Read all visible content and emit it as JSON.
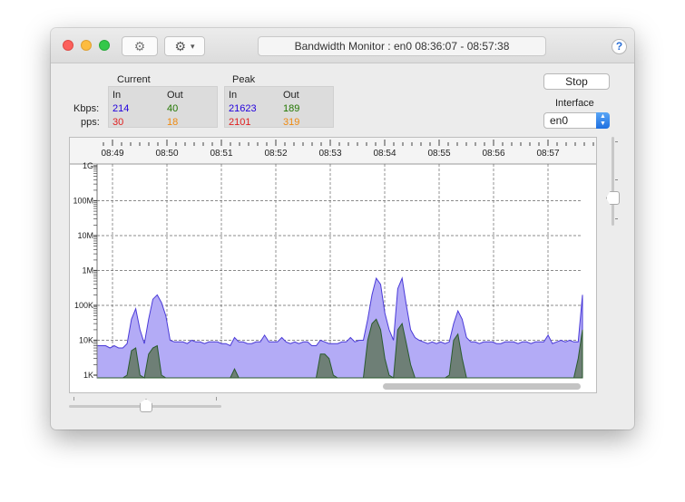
{
  "window": {
    "title": "Bandwidth Monitor : en0 08:36:07 - 08:57:38",
    "help_label": "?"
  },
  "stats": {
    "current": {
      "heading": "Current",
      "in_label": "In",
      "out_label": "Out",
      "kbps_in": "214",
      "kbps_out": "40",
      "pps_in": "30",
      "pps_out": "18"
    },
    "peak": {
      "heading": "Peak",
      "in_label": "In",
      "out_label": "Out",
      "kbps_in": "21623",
      "kbps_out": "189",
      "pps_in": "2101",
      "pps_out": "319"
    },
    "kbps_label": "Kbps:",
    "pps_label": "pps:"
  },
  "controls": {
    "stop_label": "Stop",
    "interface_label": "Interface",
    "interface_value": "en0"
  },
  "colors": {
    "in_kbps": "#2200dd",
    "out_kbps": "#227700",
    "in_pps": "#e02020",
    "out_pps": "#ef8a10",
    "in_fill": "#b3abf6",
    "in_line": "#4a3ad8",
    "out_fill": "#6e7f76",
    "out_line": "#2a5a2e"
  },
  "chart_data": {
    "type": "area",
    "time_labels": [
      "08:49",
      "08:50",
      "08:51",
      "08:52",
      "08:53",
      "08:54",
      "08:55",
      "08:56",
      "08:57"
    ],
    "y_scale": "log",
    "y_labels": [
      "1G",
      "100M",
      "10M",
      "1M",
      "100K",
      "10K",
      "1K"
    ],
    "series": [
      {
        "values": [
          7,
          7,
          7,
          6,
          7,
          6,
          6,
          8,
          40,
          80,
          20,
          8,
          40,
          150,
          200,
          120,
          50,
          10,
          9,
          9,
          9,
          8,
          10,
          9,
          9,
          8,
          9,
          9,
          9,
          8,
          8,
          7,
          12,
          9,
          9,
          8,
          8,
          9,
          9,
          14,
          9,
          9,
          9,
          12,
          9,
          8,
          9,
          8,
          9,
          9,
          7,
          7,
          10,
          9,
          8,
          8,
          8,
          9,
          9,
          12,
          9,
          10,
          10,
          40,
          200,
          600,
          400,
          60,
          20,
          10,
          300,
          600,
          100,
          20,
          12,
          10,
          9,
          8,
          9,
          8,
          9,
          8,
          9,
          30,
          70,
          40,
          12,
          9,
          9,
          8,
          9,
          9,
          9,
          8,
          8,
          9,
          9,
          9,
          8,
          9,
          9,
          8,
          9,
          9,
          9,
          14,
          8,
          9,
          10,
          9,
          10,
          9,
          9,
          200
        ]
      },
      {
        "values": [
          0.3,
          0.3,
          0.3,
          0.3,
          0.3,
          0.3,
          0.3,
          1,
          5,
          6,
          1,
          0.3,
          4,
          6,
          7,
          1,
          0.3,
          0.3,
          0.3,
          0.3,
          0.3,
          0.3,
          0.3,
          0.3,
          0.3,
          0.3,
          0.3,
          0.3,
          0.3,
          0.3,
          0.3,
          0.3,
          1.5,
          0.8,
          0.3,
          0.3,
          0.3,
          0.3,
          0.3,
          0.3,
          0.3,
          0.3,
          0.3,
          0.3,
          0.3,
          0.3,
          0.3,
          0.3,
          0.3,
          0.3,
          0.3,
          0.3,
          4,
          4,
          3,
          1,
          0.3,
          0.3,
          0.3,
          0.3,
          0.3,
          0.3,
          0.3,
          10,
          30,
          40,
          20,
          3,
          1,
          0.5,
          20,
          30,
          8,
          2,
          0.8,
          0.5,
          0.3,
          0.3,
          0.3,
          0.3,
          0.3,
          0.3,
          1,
          10,
          15,
          3,
          0.5,
          0.3,
          0.3,
          0.3,
          0.3,
          0.3,
          0.3,
          0.3,
          0.3,
          0.3,
          0.3,
          0.3,
          0.3,
          0.3,
          0.3,
          0.3,
          0.3,
          0.3,
          0.3,
          0.3,
          0.3,
          0.3,
          0.3,
          0.3,
          0.3,
          0.3,
          3,
          20
        ]
      }
    ]
  }
}
